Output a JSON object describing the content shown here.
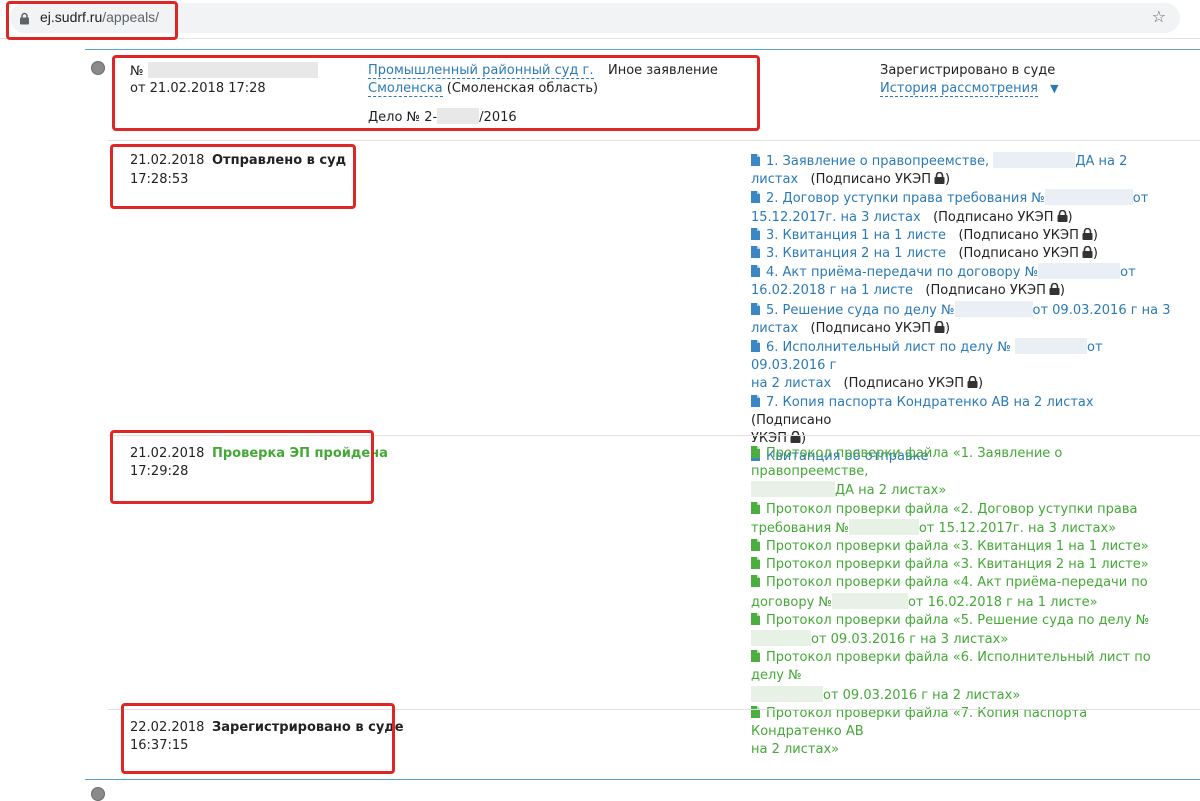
{
  "browser": {
    "url_host": "ej.sudrf.ru",
    "url_path": "/appeals/"
  },
  "appeal": {
    "number_label": "№",
    "date_line": "от 21.02.2018 17:28",
    "court_link_line1": "Промышленный районный суд г.",
    "court_link_line2": "Смоленска",
    "region": " (Смоленская область)",
    "type": "Иное заявление",
    "case_prefix": "Дело № 2-",
    "case_suffix": "/2016",
    "status": "Зарегистрировано в суде",
    "history_link": "История рассмотрения",
    "history_arrow": "▼"
  },
  "events": [
    {
      "date": "21.02.2018",
      "time": "17:28:53",
      "status": "Отправлено в суд"
    },
    {
      "date": "21.02.2018",
      "time": "17:29:28",
      "status": "Проверка ЭП пройдена"
    },
    {
      "date": "22.02.2018",
      "time": "16:37:15",
      "status": "Зарегистрировано в суде"
    }
  ],
  "signed_label": "(Подписано УКЭП",
  "closing_paren": ")",
  "files": {
    "f1_a": "1. Заявление о правопреемстве,",
    "f1_b": "ДА на 2",
    "f1_c": "листах",
    "f2_a": "2. Договор уступки права требования №",
    "f2_b": "от",
    "f2_c": "15.12.2017г. на 3 листах",
    "f3": "3. Квитанция 1 на 1 листе",
    "f3b": "3. Квитанция 2 на 1 листе",
    "f4_a": "4. Акт приёма-передачи по договору №",
    "f4_b": "от",
    "f4_c": "16.02.2018 г на 1 листе",
    "f5_a": "5. Решение суда по делу №",
    "f5_b": "от 09.03.2016 г на 3",
    "f5_c": "листах",
    "f6_a": "6. Исполнительный лист по делу №",
    "f6_b": "от 09.03.2016 г",
    "f6_c": "на 2 листах",
    "f7": "7. Копия паспорта Кондратенко АВ на 2 листах",
    "f7_signed_a": "(Подписано",
    "f7_signed_b": "УКЭП",
    "receipt": "Квитанция об отправке"
  },
  "protocols": {
    "p1_a": "Протокол проверки файла «1. Заявление о правопреемстве,",
    "p1_b": "ДА на 2 листах»",
    "p2_a": "Протокол проверки файла «2. Договор уступки права",
    "p2_b": "требования №",
    "p2_c": "от 15.12.2017г. на 3 листах»",
    "p3": "Протокол проверки файла «3. Квитанция 1 на 1 листе»",
    "p3b": "Протокол проверки файла «3. Квитанция 2 на 1 листе»",
    "p4_a": "Протокол проверки файла «4. Акт приёма-передачи по",
    "p4_b": "договору №",
    "p4_c": "от 16.02.2018 г на 1 листе»",
    "p5_a": "Протокол проверки файла «5. Решение суда по делу №",
    "p5_b": "от 09.03.2016 г на 3 листах»",
    "p6_a": "Протокол проверки файла «6. Исполнительный лист по делу №",
    "p6_b": "от 09.03.2016 г на 2 листах»",
    "p7_a": "Протокол проверки файла «7. Копия паспорта Кондратенко АВ",
    "p7_b": "на 2 листах»"
  }
}
